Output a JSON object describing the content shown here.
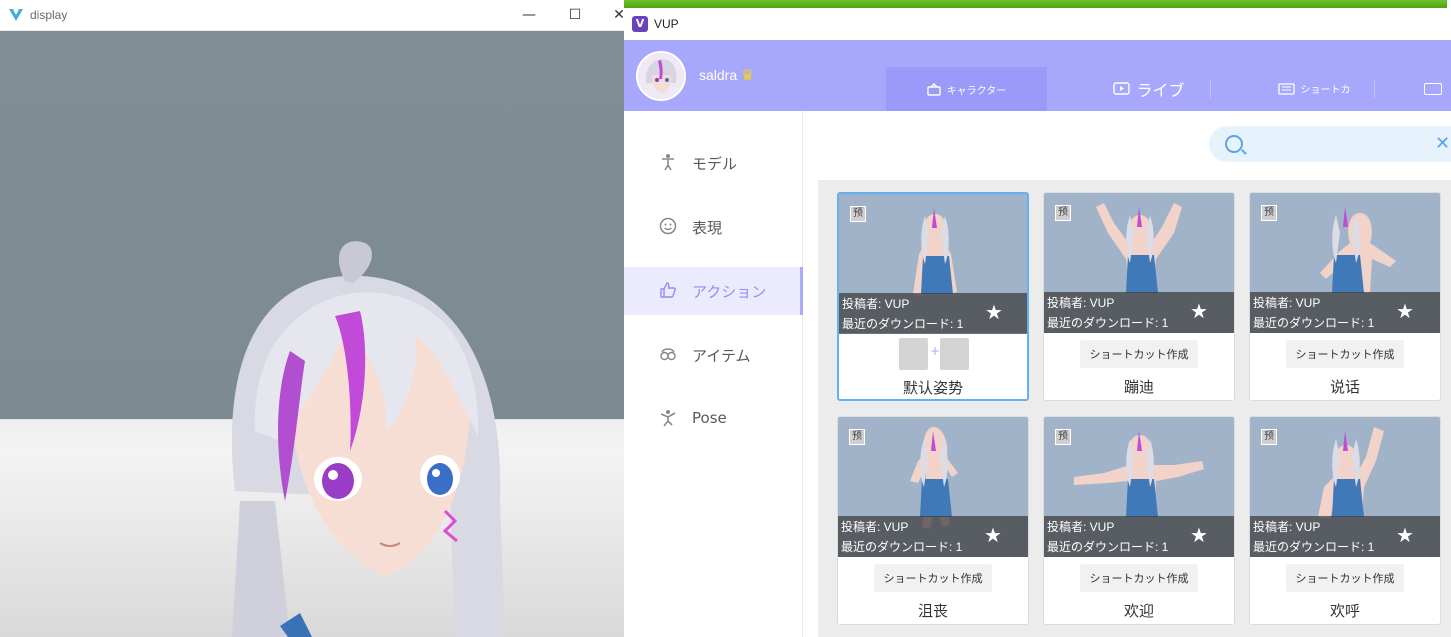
{
  "display_window": {
    "title": "display",
    "minimize_glyph": "—",
    "maximize_glyph": "☐",
    "close_glyph": "✕"
  },
  "progress": {
    "fraction": 0.995,
    "color": "#5bb21f"
  },
  "vup_window": {
    "title": "VUP",
    "logo_letter": "V"
  },
  "header": {
    "username": "saldra",
    "crown_glyph": "♛",
    "tabs": [
      {
        "label": "キャラクター",
        "icon": "character-icon",
        "active": true
      },
      {
        "label": "ライブ",
        "icon": "live-icon",
        "active": false
      },
      {
        "label": "ショートカ",
        "icon": "keyboard-icon",
        "active": false
      },
      {
        "label": "",
        "icon": "image-icon",
        "active": false
      }
    ]
  },
  "sidebar": {
    "items": [
      {
        "label": "モデル",
        "icon": "model-icon",
        "active": false
      },
      {
        "label": "表現",
        "icon": "face-icon",
        "active": false
      },
      {
        "label": "アクション",
        "icon": "thumbs-up-icon",
        "active": true
      },
      {
        "label": "アイテム",
        "icon": "goggles-icon",
        "active": false
      },
      {
        "label": "Pose",
        "icon": "pose-icon",
        "active": false
      }
    ]
  },
  "search": {
    "placeholder": "",
    "value": "",
    "clear_glyph": "✕"
  },
  "cards": [
    {
      "name": "默认姿势",
      "poster": "投稿者: VUP",
      "downloads": "最近のダウンロード: 1",
      "badge": "预",
      "selected": true,
      "has_shortcut": true,
      "shortcut_label": "",
      "key_plus": "+"
    },
    {
      "name": "蹦迪",
      "poster": "投稿者: VUP",
      "downloads": "最近のダウンロード: 1",
      "badge": "预",
      "selected": false,
      "has_shortcut": false,
      "shortcut_label": "ショートカット作成"
    },
    {
      "name": "说话",
      "poster": "投稿者: VUP",
      "downloads": "最近のダウンロード: 1",
      "badge": "预",
      "selected": false,
      "has_shortcut": false,
      "shortcut_label": "ショートカット作成"
    },
    {
      "name": "沮丧",
      "poster": "投稿者: VUP",
      "downloads": "最近のダウンロード: 1",
      "badge": "预",
      "selected": false,
      "has_shortcut": false,
      "shortcut_label": "ショートカット作成"
    },
    {
      "name": "欢迎",
      "poster": "投稿者: VUP",
      "downloads": "最近のダウンロード: 1",
      "badge": "预",
      "selected": false,
      "has_shortcut": false,
      "shortcut_label": "ショートカット作成"
    },
    {
      "name": "欢呼",
      "poster": "投稿者: VUP",
      "downloads": "最近のダウンロード: 1",
      "badge": "预",
      "selected": false,
      "has_shortcut": false,
      "shortcut_label": "ショートカット作成"
    }
  ],
  "colors": {
    "header_bg": "#a7a8fb",
    "active_tab_bg": "#9a9bf8",
    "accent": "#8f90f5",
    "selected_card_border": "#62b2f3",
    "search_bg": "#e6f2fc"
  },
  "fav_glyph": "★"
}
